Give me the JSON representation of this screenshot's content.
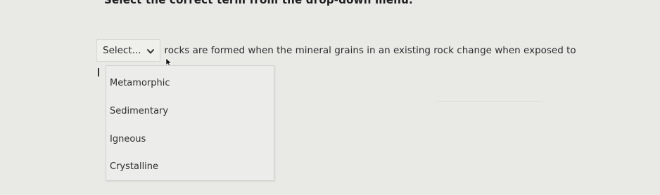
{
  "instruction": "Select the correct term from the drop-down menu.",
  "question": {
    "select_placeholder": "Select...",
    "text": "rocks are formed when the mineral grains in an existing rock change when exposed to"
  },
  "dropdown": {
    "options": [
      "Metamorphic",
      "Sedimentary",
      "Igneous",
      "Crystalline"
    ]
  },
  "icons": {
    "select_chevron": "chevron-down-icon",
    "pointer": "mouse-cursor-icon"
  }
}
